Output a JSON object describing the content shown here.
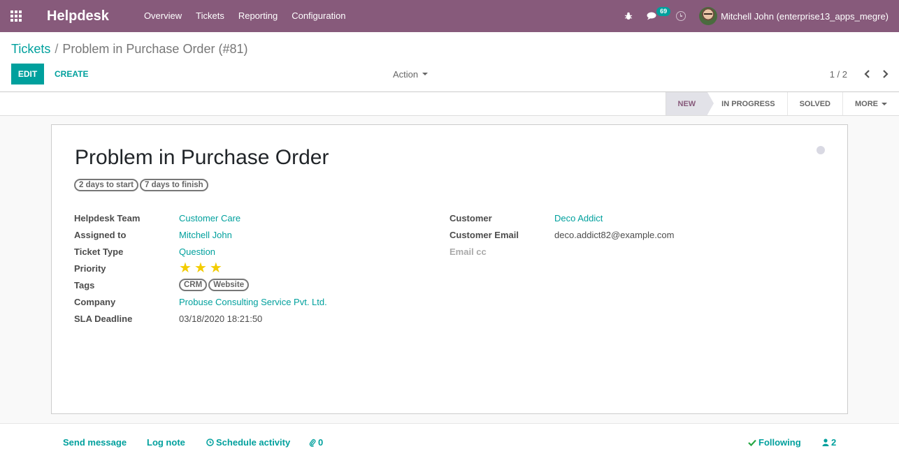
{
  "navbar": {
    "brand": "Helpdesk",
    "menu": [
      "Overview",
      "Tickets",
      "Reporting",
      "Configuration"
    ],
    "messages_count": "69",
    "user_name": "Mitchell John (enterprise13_apps_megre)",
    "icons": [
      "apps-grid-icon",
      "bug-icon",
      "chat-icon",
      "clock-icon"
    ]
  },
  "breadcrumb": {
    "parent": "Tickets",
    "separator": "/",
    "current": "Problem in Purchase Order (#81)"
  },
  "toolbar": {
    "edit_label": "EDIT",
    "create_label": "CREATE",
    "action_label": "Action",
    "pager_value": "1 / 2"
  },
  "stages": [
    {
      "label": "NEW",
      "active": true
    },
    {
      "label": "IN PROGRESS",
      "active": false
    },
    {
      "label": "SOLVED",
      "active": false
    }
  ],
  "stage_more": "MORE",
  "ticket": {
    "title": "Problem in Purchase Order",
    "sla_badges": [
      "2 days to start",
      "7 days to finish"
    ],
    "left_fields": {
      "team_label": "Helpdesk Team",
      "team_value": "Customer Care",
      "assigned_label": "Assigned to",
      "assigned_value": "Mitchell John",
      "type_label": "Ticket Type",
      "type_value": "Question",
      "priority_label": "Priority",
      "priority_stars": 3,
      "tags_label": "Tags",
      "tags": [
        "CRM",
        "Website"
      ],
      "company_label": "Company",
      "company_value": "Probuse Consulting Service Pvt. Ltd.",
      "sla_label": "SLA Deadline",
      "sla_value": "03/18/2020 18:21:50"
    },
    "right_fields": {
      "customer_label": "Customer",
      "customer_value": "Deco Addict",
      "email_label": "Customer Email",
      "email_value": "deco.addict82@example.com",
      "cc_label": "Email cc"
    }
  },
  "chatter": {
    "send_message": "Send message",
    "log_note": "Log note",
    "schedule_activity": "Schedule activity",
    "attachments": "0",
    "following": "Following",
    "followers": "2"
  },
  "colors": {
    "navbar": "#875a7b",
    "accent": "#00a09d",
    "star": "#f3cc00"
  }
}
